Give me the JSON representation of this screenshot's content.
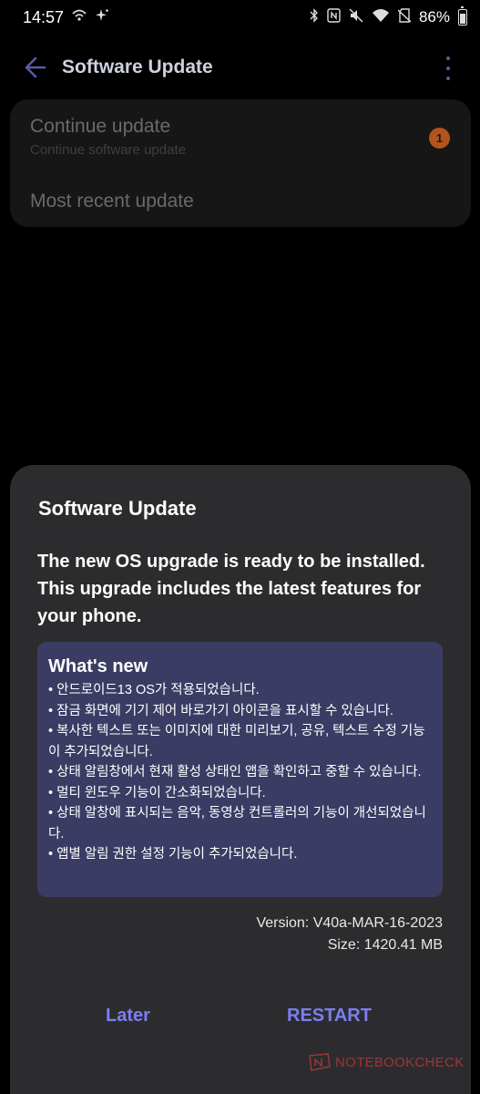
{
  "status_bar": {
    "time": "14:57",
    "battery_percent": "86%",
    "battery_level": 0.86,
    "left_icons": [
      "wifi-calling-icon",
      "sparkle-icon"
    ],
    "right_icons": [
      "bluetooth-icon",
      "nfc-icon",
      "mute-icon",
      "wifi-icon",
      "no-sim-icon"
    ]
  },
  "app_bar": {
    "title": "Software Update",
    "accent_color": "#5a5aa8"
  },
  "settings": {
    "items": [
      {
        "title": "Continue update",
        "subtitle": "Continue software update",
        "badge": "1"
      },
      {
        "title": "Most recent update"
      }
    ]
  },
  "dialog": {
    "title": "Software Update",
    "message": "The new OS upgrade is ready to be installed. This upgrade includes the latest features for your phone.",
    "whats_new": {
      "title": "What's new",
      "items": [
        "• 안드로이드13 OS가 적용되었습니다.",
        "• 잠금 화면에 기기 제어 바로가기 아이콘을 표시할 수 있습니다.",
        "• 복사한 텍스트 또는 이미지에 대한 미리보기, 공유, 텍스트 수정 기능이 추가되었습니다.",
        "• 상태 알림창에서 현재 활성 상태인 앱을 확인하고 중할 수 있습니다.",
        "• 멀티 윈도우 기능이 간소화되었습니다.",
        "• 상태 알창에 표시되는 음악, 동영상 컨트롤러의 기능이 개선되었습니다.",
        "• 앱별 알림 권한 설정 기능이 추가되었습니다."
      ]
    },
    "version": "Version: V40a-MAR-16-2023",
    "size": "Size: 1420.41 MB",
    "later_label": "Later",
    "restart_label": "RESTART",
    "button_color": "#7b7ef2",
    "panel_color": "#3b3c64"
  },
  "watermark": {
    "text": "NOTEBOOKCHECK"
  }
}
